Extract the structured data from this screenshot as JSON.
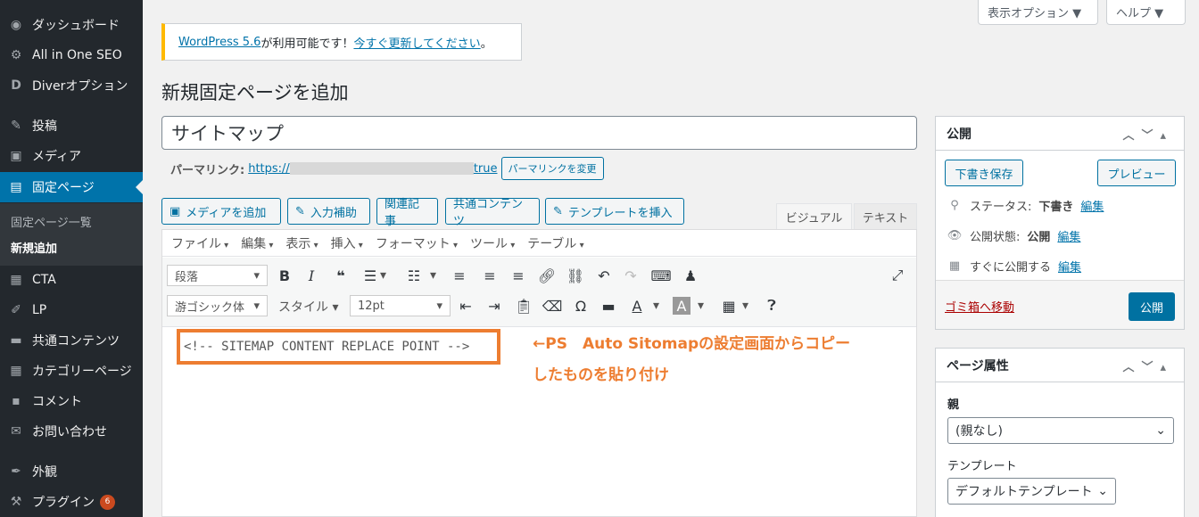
{
  "sidebar": {
    "items": [
      {
        "label": "ダッシュボード",
        "icon": "dashboard-icon"
      },
      {
        "label": "All in One SEO",
        "icon": "gear-icon"
      },
      {
        "label": "Diverオプション",
        "icon": "diver-icon"
      },
      {
        "label": "投稿",
        "icon": "pin-icon"
      },
      {
        "label": "メディア",
        "icon": "media-icon"
      },
      {
        "label": "固定ページ",
        "icon": "page-icon"
      },
      {
        "label": "CTA",
        "icon": "cta-icon"
      },
      {
        "label": "LP",
        "icon": "lp-icon"
      },
      {
        "label": "共通コンテンツ",
        "icon": "folder-icon"
      },
      {
        "label": "カテゴリーページ",
        "icon": "category-icon"
      },
      {
        "label": "コメント",
        "icon": "comment-icon"
      },
      {
        "label": "お問い合わせ",
        "icon": "mail-icon"
      },
      {
        "label": "外観",
        "icon": "brush-icon"
      },
      {
        "label": "プラグイン",
        "icon": "plugin-icon",
        "badge": "6"
      }
    ],
    "submenu": [
      "固定ページ一覧",
      "新規追加"
    ]
  },
  "top_buttons": {
    "screen_options": "表示オプション ▼",
    "help": "ヘルプ ▼"
  },
  "notice": {
    "link1": "WordPress 5.6",
    "middle": " が利用可能です！",
    "link2": "今すぐ更新してください",
    "end": "。"
  },
  "page_title": "新規固定ページを追加",
  "post_title": "サイトマップ",
  "permalink": {
    "label": "パーマリンク:",
    "url_start": "https://",
    "url_end": "true",
    "change_button": "パーマリンクを変更"
  },
  "media_buttons": [
    "メディアを追加",
    "入力補助",
    "関連記事",
    "共通コンテンツ",
    "テンプレートを挿入"
  ],
  "editor_tabs": {
    "visual": "ビジュアル",
    "text": "テキスト"
  },
  "menubar": [
    "ファイル",
    "編集",
    "表示",
    "挿入",
    "フォーマット",
    "ツール",
    "テーブル"
  ],
  "toolbar": {
    "format": "段落",
    "font": "游ゴシック体",
    "style": "スタイル",
    "size": "12pt"
  },
  "content": {
    "sitemap_code": "<!-- SITEMAP CONTENT REPLACE POINT -->"
  },
  "annotation": {
    "line1": "←PS　Auto Sitomapの設定画面からコピー",
    "line2": "したものを貼り付け"
  },
  "publish": {
    "title": "公開",
    "save_draft": "下書き保存",
    "preview": "プレビュー",
    "status_label": "ステータス:",
    "status_value": "下書き",
    "visibility_label": "公開状態:",
    "visibility_value": "公開",
    "schedule_label": "すぐに公開する",
    "edit": "編集",
    "trash": "ゴミ箱へ移動",
    "publish_button": "公開"
  },
  "attributes": {
    "title": "ページ属性",
    "parent_label": "親",
    "parent_value": "(親なし)",
    "template_label": "テンプレート",
    "template_value": "デフォルトテンプレート"
  },
  "colors": {
    "accent": "#0073aa",
    "annotation": "#ed7d31",
    "sidebar": "#23282d",
    "notice": "#ffb900"
  }
}
